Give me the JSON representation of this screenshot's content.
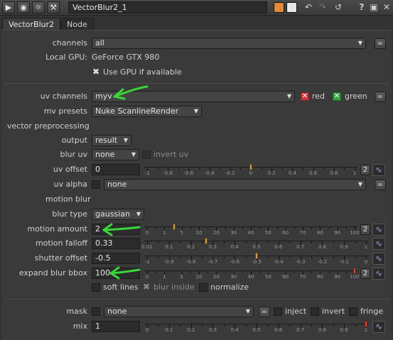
{
  "titlebar": {
    "node_name": "VectorBlur2_1",
    "help_label": "?",
    "colors": {
      "orange_swatch": "#e08a3a",
      "white_swatch": "#e8e8e8"
    }
  },
  "tabs": [
    {
      "label": "VectorBlur2",
      "active": true
    },
    {
      "label": "Node",
      "active": false
    }
  ],
  "knobs": {
    "channels": {
      "label": "channels",
      "value": "all"
    },
    "local_gpu": {
      "label": "Local GPU:",
      "value": "GeForce GTX 980"
    },
    "use_gpu": {
      "label": "Use GPU if available",
      "checked": true
    },
    "uv_channels": {
      "label": "uv channels",
      "value": "myv",
      "red_label": "red",
      "green_label": "green"
    },
    "mv_presets": {
      "label": "mv presets",
      "value": "Nuke ScanlineRender"
    },
    "vector_preprocessing": {
      "label": "vector preprocessing"
    },
    "output": {
      "label": "output",
      "value": "result"
    },
    "blur_uv": {
      "label": "blur uv",
      "value": "none",
      "invert_label": "invert uv"
    },
    "uv_offset": {
      "label": "uv offset",
      "value": "0",
      "ticks": [
        "-1",
        "-0.8",
        "-0.6",
        "-0.4",
        "-0.2",
        "0",
        "0.2",
        "0.4",
        "0.6",
        "0.8",
        "1"
      ],
      "anim_count": "2",
      "fill_fraction": 0.5
    },
    "uv_alpha": {
      "label": "uv alpha",
      "value": "none"
    },
    "motion_blur": {
      "label": "motion blur"
    },
    "blur_type": {
      "label": "blur type",
      "value": "gaussian"
    },
    "motion_amount": {
      "label": "motion amount",
      "value": "2",
      "ticks": [
        "0",
        "1",
        "5",
        "10",
        "20",
        "30",
        "40",
        "50",
        "60",
        "70",
        "80",
        "90",
        "100"
      ],
      "anim_count": "2",
      "fill_fraction": 0.13
    },
    "motion_falloff": {
      "label": "motion falloff",
      "value": "0.33",
      "ticks": [
        "0.01",
        "0.1",
        "0.2",
        "0.3",
        "0.4",
        "0.5",
        "0.6",
        "0.7",
        "0.8",
        "0.9",
        "1"
      ],
      "fill_fraction": 0.27
    },
    "shutter_offset": {
      "label": "shutter offset",
      "value": "-0.5",
      "ticks": [
        "-1",
        "-0.9",
        "-0.8",
        "-0.7",
        "-0.6",
        "-0.5",
        "-0.4",
        "-0.3",
        "-0.2",
        "-0.1",
        "0"
      ],
      "fill_fraction": 0.5
    },
    "expand_blur_bbox": {
      "label": "expand blur bbox",
      "value": "100",
      "ticks": [
        "0",
        "1",
        "5",
        "10",
        "20",
        "30",
        "40",
        "50",
        "60",
        "70",
        "80",
        "90",
        "100"
      ],
      "anim_count": "2",
      "fill_fraction": 1.0
    },
    "soft_lines": {
      "label": "soft lines"
    },
    "blur_inside": {
      "label": "blur inside",
      "checked": true
    },
    "normalize": {
      "label": "normalize"
    },
    "mask": {
      "label": "mask",
      "value": "none",
      "inject_label": "inject",
      "invert_label": "invert",
      "fringe_label": "fringe"
    },
    "mix": {
      "label": "mix",
      "value": "1",
      "ticks": [
        "0",
        "0.1",
        "0.2",
        "0.3",
        "0.4",
        "0.5",
        "0.6",
        "0.7",
        "0.8",
        "0.9",
        "1"
      ],
      "fill_fraction": 1.0
    }
  },
  "annotation_color": "#39d639"
}
